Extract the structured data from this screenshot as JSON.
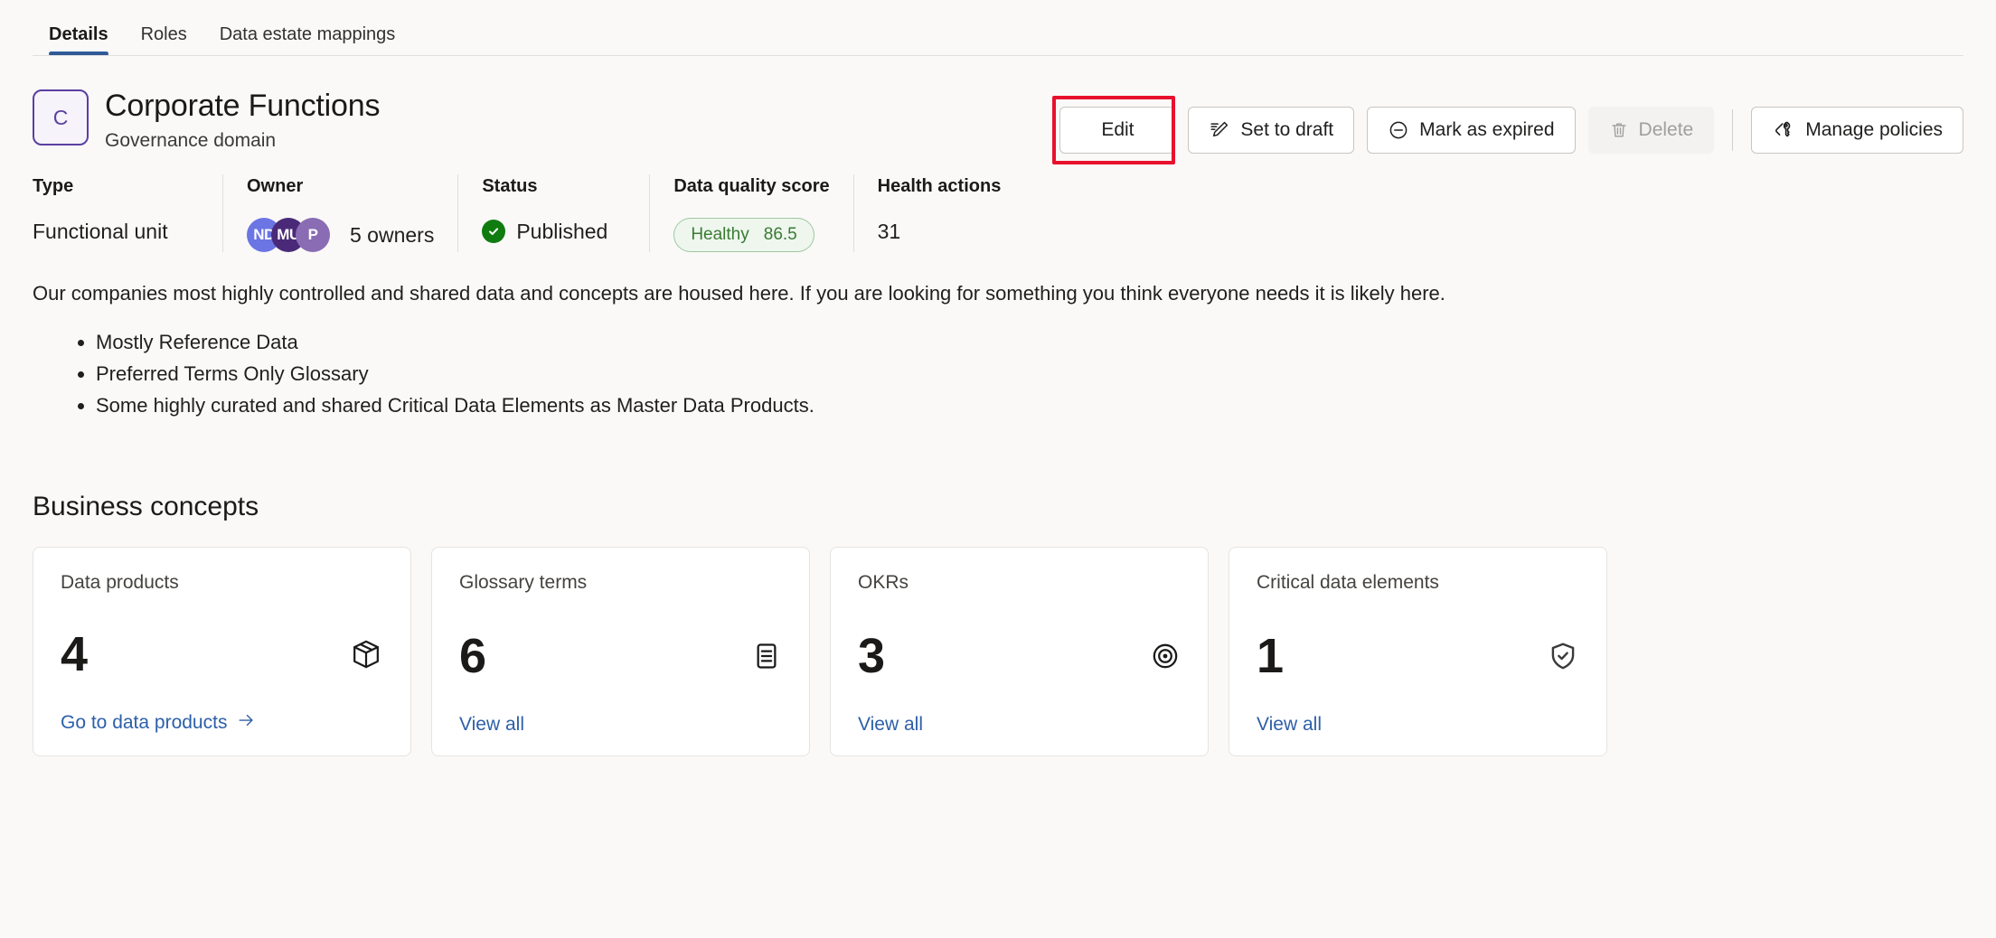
{
  "tabs": [
    {
      "label": "Details",
      "active": true
    },
    {
      "label": "Roles",
      "active": false
    },
    {
      "label": "Data estate mappings",
      "active": false
    }
  ],
  "header": {
    "avatar_initial": "C",
    "title": "Corporate Functions",
    "subtitle": "Governance domain"
  },
  "actions": {
    "edit": "Edit",
    "set_to_draft": "Set to draft",
    "mark_as_expired": "Mark as expired",
    "delete": "Delete",
    "manage_policies": "Manage policies",
    "highlight_color": "#e8112d"
  },
  "meta": {
    "type": {
      "label": "Type",
      "value": "Functional unit"
    },
    "owner": {
      "label": "Owner",
      "avatars": [
        {
          "initials": "ND",
          "color": "#6b75e3"
        },
        {
          "initials": "MU",
          "color": "#4a2a78"
        },
        {
          "initials": "P",
          "color": "#8a6cb4"
        }
      ],
      "count_text": "5 owners"
    },
    "status": {
      "label": "Status",
      "value": "Published",
      "color": "#107c10"
    },
    "data_quality": {
      "label": "Data quality score",
      "state": "Healthy",
      "score": "86.5",
      "color": "#3a7a32"
    },
    "health_actions": {
      "label": "Health actions",
      "value": "31"
    }
  },
  "description": {
    "paragraph": "Our companies most highly controlled and shared data and concepts are housed here. If you are looking for something you think everyone needs it is likely here.",
    "bullets": [
      "Mostly Reference Data",
      "Preferred Terms Only Glossary",
      "Some highly curated and shared Critical Data Elements as Master Data Products."
    ]
  },
  "business_concepts": {
    "title": "Business concepts",
    "cards": [
      {
        "label": "Data products",
        "count": "4",
        "link": "Go to data products",
        "icon": "box-icon",
        "has_arrow": true
      },
      {
        "label": "Glossary terms",
        "count": "6",
        "link": "View all",
        "icon": "document-icon",
        "has_arrow": false
      },
      {
        "label": "OKRs",
        "count": "3",
        "link": "View all",
        "icon": "target-icon",
        "has_arrow": false
      },
      {
        "label": "Critical data elements",
        "count": "1",
        "link": "View all",
        "icon": "shield-check-icon",
        "has_arrow": false
      }
    ]
  }
}
